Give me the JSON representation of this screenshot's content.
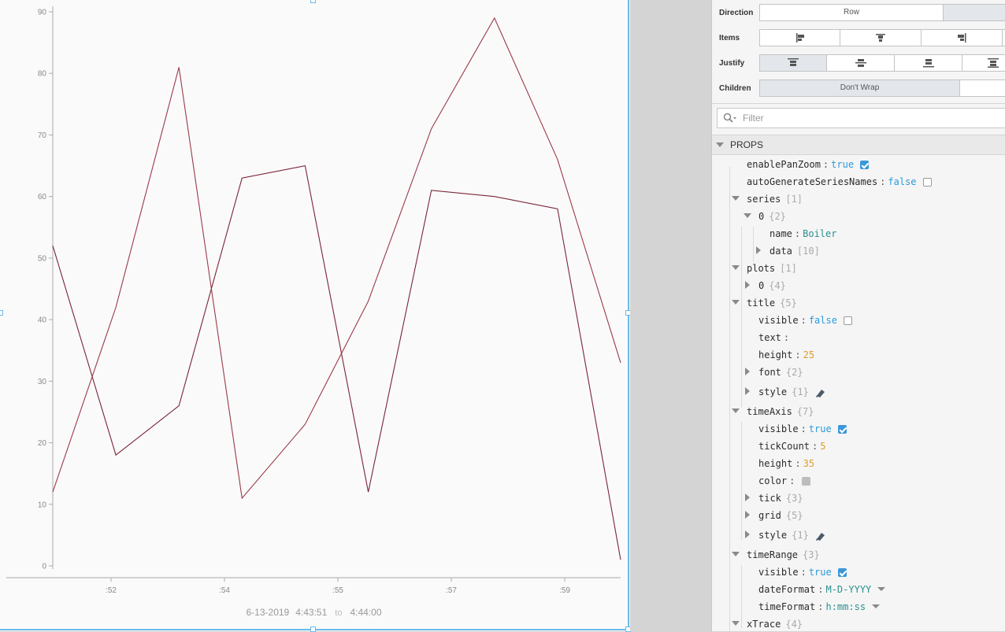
{
  "chart_data": {
    "type": "line",
    "x_tick_labels": [
      ":52",
      ":54",
      ":55",
      ":57",
      ":59"
    ],
    "y_ticks": [
      0,
      10,
      20,
      30,
      40,
      50,
      60,
      70,
      80,
      90
    ],
    "ylim": [
      0,
      90
    ],
    "series": [
      {
        "values": [
          52,
          18,
          26,
          63,
          65,
          12,
          61,
          60,
          58,
          1
        ],
        "color": "#7a2438"
      },
      {
        "values": [
          12,
          42,
          81,
          11,
          23,
          43,
          71,
          89,
          66,
          33
        ],
        "color": "#9a3a4a"
      }
    ],
    "grid": false,
    "legend": "none"
  },
  "time_range": {
    "date": "6-13-2019",
    "start": "4:43:51",
    "to": "to",
    "end": "4:44:00"
  },
  "layout": {
    "direction": {
      "label": "Direction",
      "options": [
        "Row",
        ""
      ]
    },
    "items": {
      "label": "Items"
    },
    "justify": {
      "label": "Justify"
    },
    "children": {
      "label": "Children",
      "options": [
        "Don't Wrap",
        ""
      ]
    }
  },
  "filter": {
    "placeholder": "Filter"
  },
  "props": {
    "header": "PROPS",
    "rows": [
      {
        "key": "enablePanZoom",
        "value": "true",
        "vtype": "bool",
        "checkbox": "on"
      },
      {
        "key": "autoGenerateSeriesNames",
        "value": "false",
        "vtype": "bool",
        "checkbox": "off"
      },
      {
        "key": "series",
        "count": "[1]"
      },
      {
        "key": "0",
        "count": "{2}"
      },
      {
        "key": "name",
        "value": "Boiler",
        "vtype": "str"
      },
      {
        "key": "data",
        "count": "[10]"
      },
      {
        "key": "plots",
        "count": "[1]"
      },
      {
        "key": "0",
        "count": "{4}"
      },
      {
        "key": "title",
        "count": "{5}"
      },
      {
        "key": "visible",
        "value": "false",
        "vtype": "bool",
        "checkbox": "off"
      },
      {
        "key": "text",
        "value": "",
        "vtype": "str"
      },
      {
        "key": "height",
        "value": "25",
        "vtype": "num"
      },
      {
        "key": "font",
        "count": "{2}"
      },
      {
        "key": "style",
        "count": "{1}"
      },
      {
        "key": "timeAxis",
        "count": "{7}"
      },
      {
        "key": "visible",
        "value": "true",
        "vtype": "bool",
        "checkbox": "on"
      },
      {
        "key": "tickCount",
        "value": "5",
        "vtype": "num"
      },
      {
        "key": "height",
        "value": "35",
        "vtype": "num"
      },
      {
        "key": "color",
        "value": "",
        "vtype": "str"
      },
      {
        "key": "tick",
        "count": "{3}"
      },
      {
        "key": "grid",
        "count": "{5}"
      },
      {
        "key": "style",
        "count": "{1}"
      },
      {
        "key": "timeRange",
        "count": "{3}"
      },
      {
        "key": "visible",
        "value": "true",
        "vtype": "bool",
        "checkbox": "on"
      },
      {
        "key": "dateFormat",
        "value": "M-D-YYYY",
        "vtype": "str"
      },
      {
        "key": "timeFormat",
        "value": "h:mm:ss",
        "vtype": "str"
      },
      {
        "key": "xTrace",
        "count": "{4}"
      }
    ]
  }
}
